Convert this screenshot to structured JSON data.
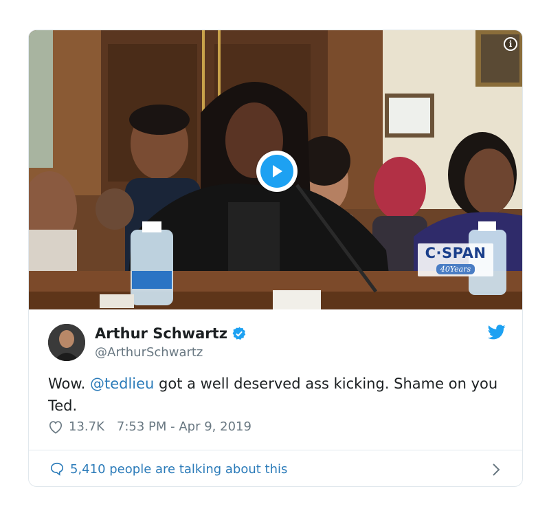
{
  "media": {
    "video_badge": {
      "logo": "C·SPAN",
      "subtitle": "40Years"
    },
    "info_glyph": "i"
  },
  "tweet": {
    "author_name": "Arthur Schwartz",
    "handle": "@ArthurSchwartz",
    "text_before": "Wow. ",
    "mention": "@tedlieu",
    "text_after": " got a well deserved ass kicking. Shame on you Ted.",
    "likes": "13.7K",
    "timestamp": "7:53 PM - Apr 9, 2019"
  },
  "footer": {
    "talking_label": "5,410 people are talking about this"
  },
  "colors": {
    "accent": "#1da1f2",
    "link": "#2b7bb9",
    "muted": "#697882",
    "border": "#e1e8ed"
  }
}
